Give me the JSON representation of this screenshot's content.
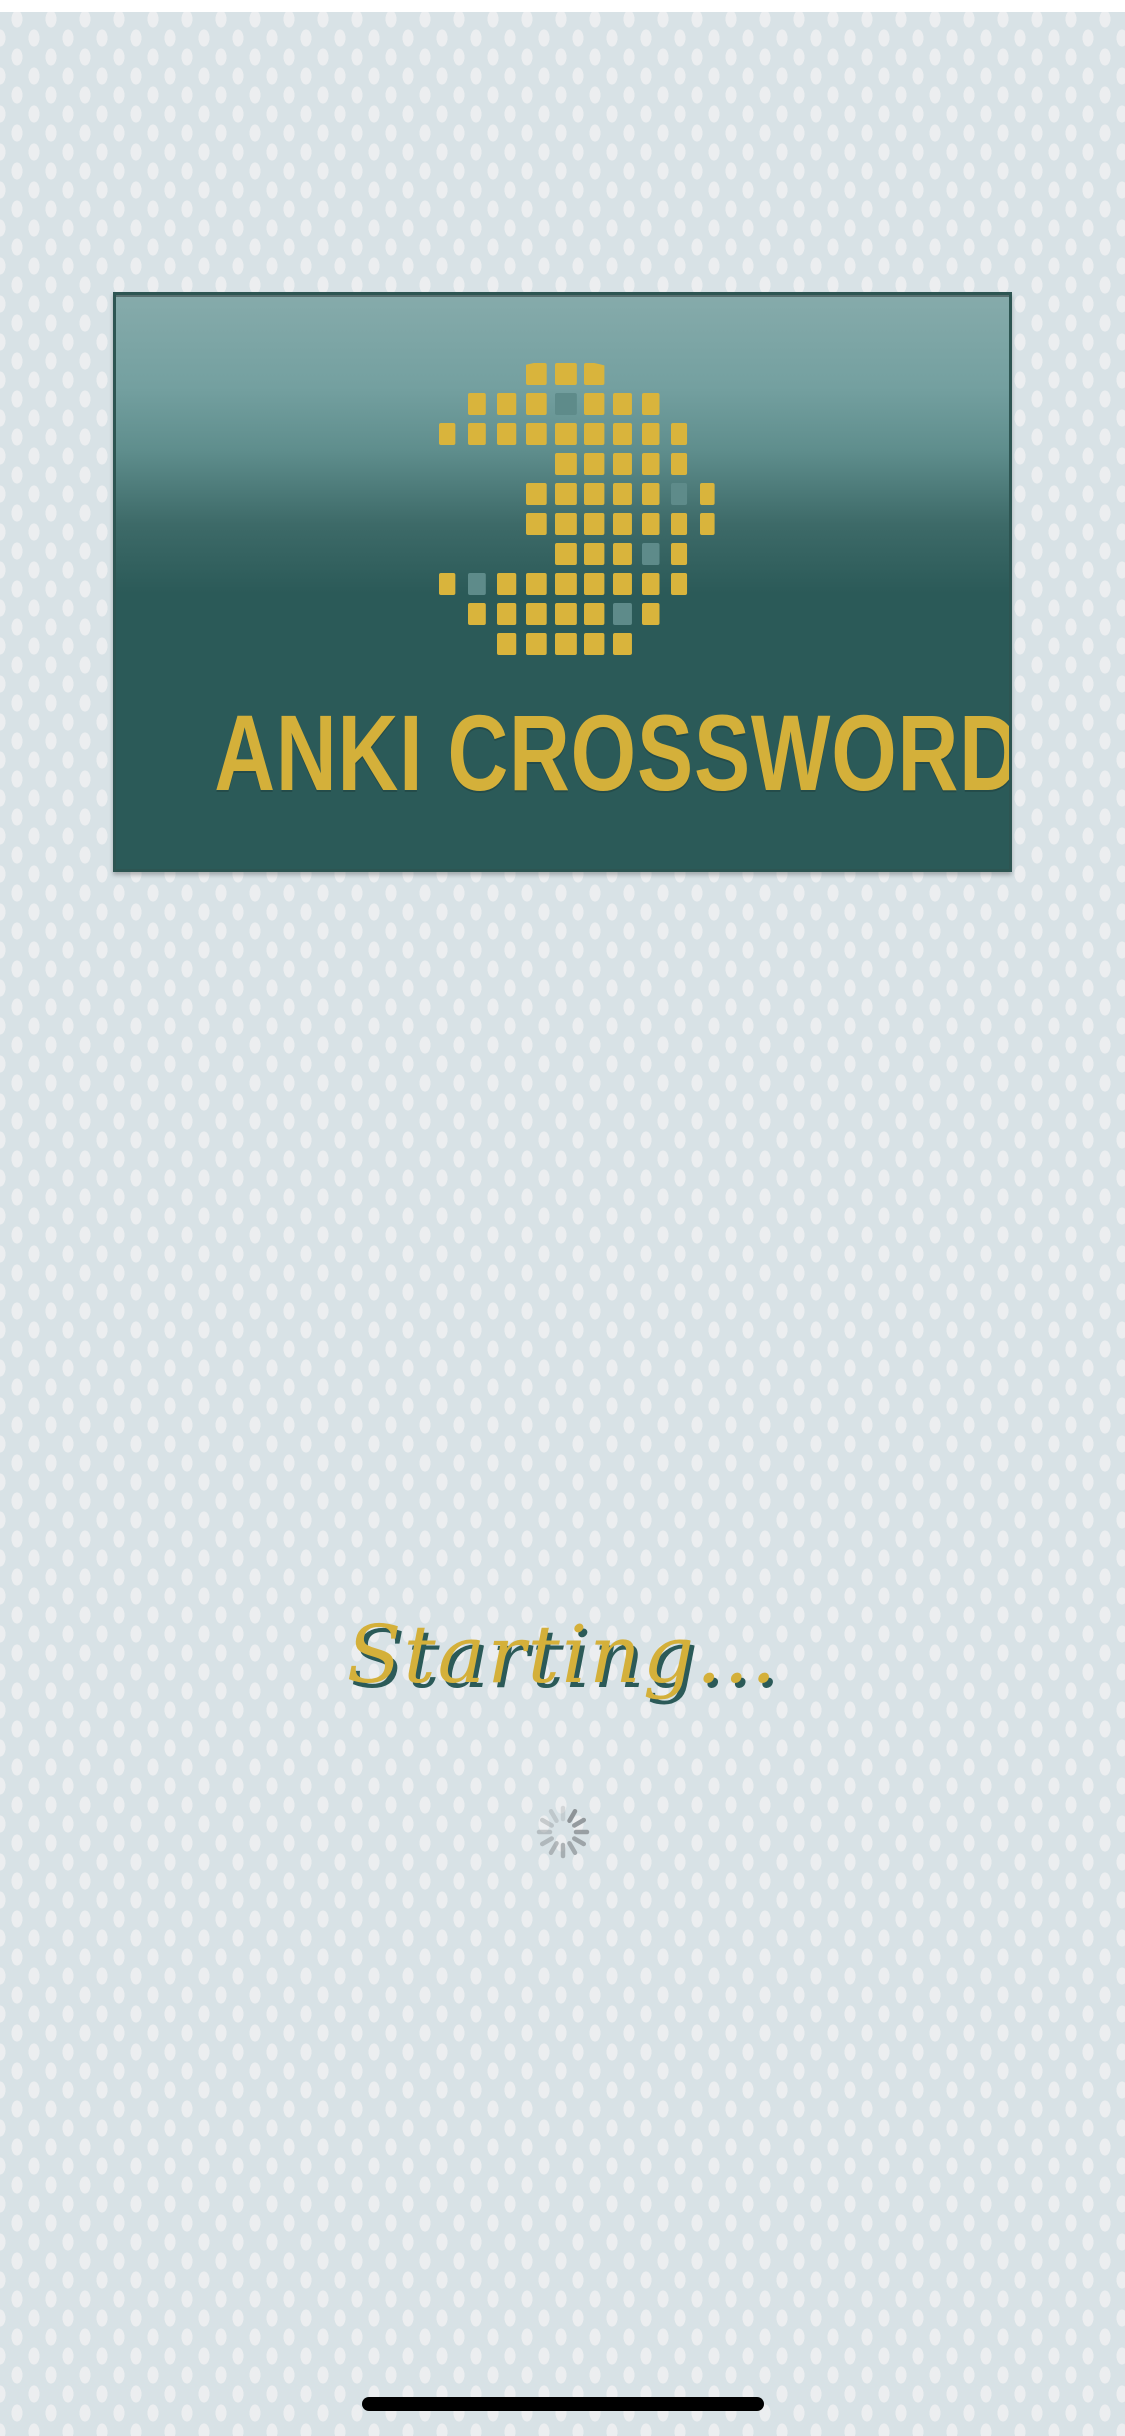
{
  "app": {
    "logo_title": "ANKI CROSSWORD",
    "status_text": "Starting..."
  },
  "colors": {
    "background": "#d8e2e6",
    "logo_panel": "#2b5a58",
    "accent_gold": "#d4b03a"
  },
  "icons": {
    "logo_globe": "crossword-globe-icon",
    "spinner": "loading-spinner-icon"
  }
}
